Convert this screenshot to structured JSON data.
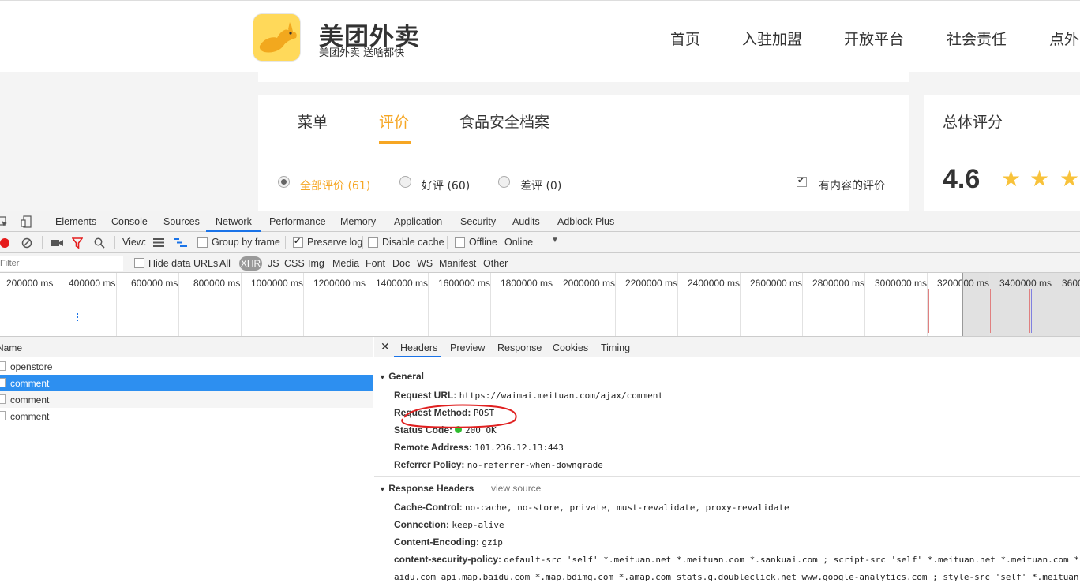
{
  "site": {
    "brand": {
      "title": "美团外卖",
      "slogan": "美团外卖 送啥都快"
    },
    "nav": [
      "首页",
      "入驻加盟",
      "开放平台",
      "社会责任",
      "点外"
    ],
    "tabs": [
      "菜单",
      "评价",
      "食品安全档案"
    ],
    "active_tab": "评价",
    "filters": [
      {
        "label": "全部评价 (61)",
        "checked": true
      },
      {
        "label": "好评 (60)",
        "checked": false
      },
      {
        "label": "差评 (0)",
        "checked": false
      }
    ],
    "content_only": {
      "label": "有内容的评价",
      "checked": true
    },
    "score": {
      "title": "总体评分",
      "value": "4.6",
      "stars": "★"
    },
    "accent_color": "#f6a623"
  },
  "devtools": {
    "tabs": [
      "Elements",
      "Console",
      "Sources",
      "Network",
      "Performance",
      "Memory",
      "Application",
      "Security",
      "Audits",
      "Adblock Plus"
    ],
    "active_tab": "Network",
    "toolbar": {
      "view_label": "View:",
      "group_by_frame": "Group by frame",
      "preserve_log": "Preserve log",
      "disable_cache": "Disable cache",
      "offline": "Offline",
      "throttle": "Online"
    },
    "filter": {
      "placeholder": "Filter",
      "hide_data_urls": "Hide data URLs",
      "types": [
        "All",
        "XHR",
        "JS",
        "CSS",
        "Img",
        "Media",
        "Font",
        "Doc",
        "WS",
        "Manifest",
        "Other"
      ],
      "active_type": "XHR"
    },
    "timeline_ticks": [
      "200000 ms",
      "400000 ms",
      "600000 ms",
      "800000 ms",
      "1000000 ms",
      "1200000 ms",
      "1400000 ms",
      "1600000 ms",
      "1800000 ms",
      "2000000 ms",
      "2200000 ms",
      "2400000 ms",
      "2600000 ms",
      "2800000 ms",
      "3000000 ms",
      "3200000 ms",
      "3400000 ms",
      "3600"
    ],
    "list": {
      "header": "Name",
      "rows": [
        "openstore",
        "comment",
        "comment",
        "comment"
      ],
      "selected_index": 1
    },
    "detail": {
      "tabs": [
        "Headers",
        "Preview",
        "Response",
        "Cookies",
        "Timing"
      ],
      "active_tab": "Headers",
      "general_title": "General",
      "general": [
        {
          "k": "Request URL:",
          "v": "https://waimai.meituan.com/ajax/comment"
        },
        {
          "k": "Request Method:",
          "v": "POST"
        },
        {
          "k": "Status Code:",
          "v": "200 OK"
        },
        {
          "k": "Remote Address:",
          "v": "101.236.12.13:443"
        },
        {
          "k": "Referrer Policy:",
          "v": "no-referrer-when-downgrade"
        }
      ],
      "response_title": "Response Headers",
      "view_source": "view source",
      "response": [
        {
          "k": "Cache-Control:",
          "v": "no-cache, no-store, private, must-revalidate, proxy-revalidate"
        },
        {
          "k": "Connection:",
          "v": "keep-alive"
        },
        {
          "k": "Content-Encoding:",
          "v": "gzip"
        },
        {
          "k": "content-security-policy:",
          "v": "default-src 'self' *.meituan.net *.meituan.com *.sankuai.com ; script-src 'self' *.meituan.net *.meituan.com *."
        },
        {
          "k": "",
          "v": "aidu.com api.map.baidu.com *.map.bdimg.com *.amap.com stats.g.doubleclick.net www.google-analytics.com ; style-src 'self' *.meituan."
        }
      ]
    }
  }
}
